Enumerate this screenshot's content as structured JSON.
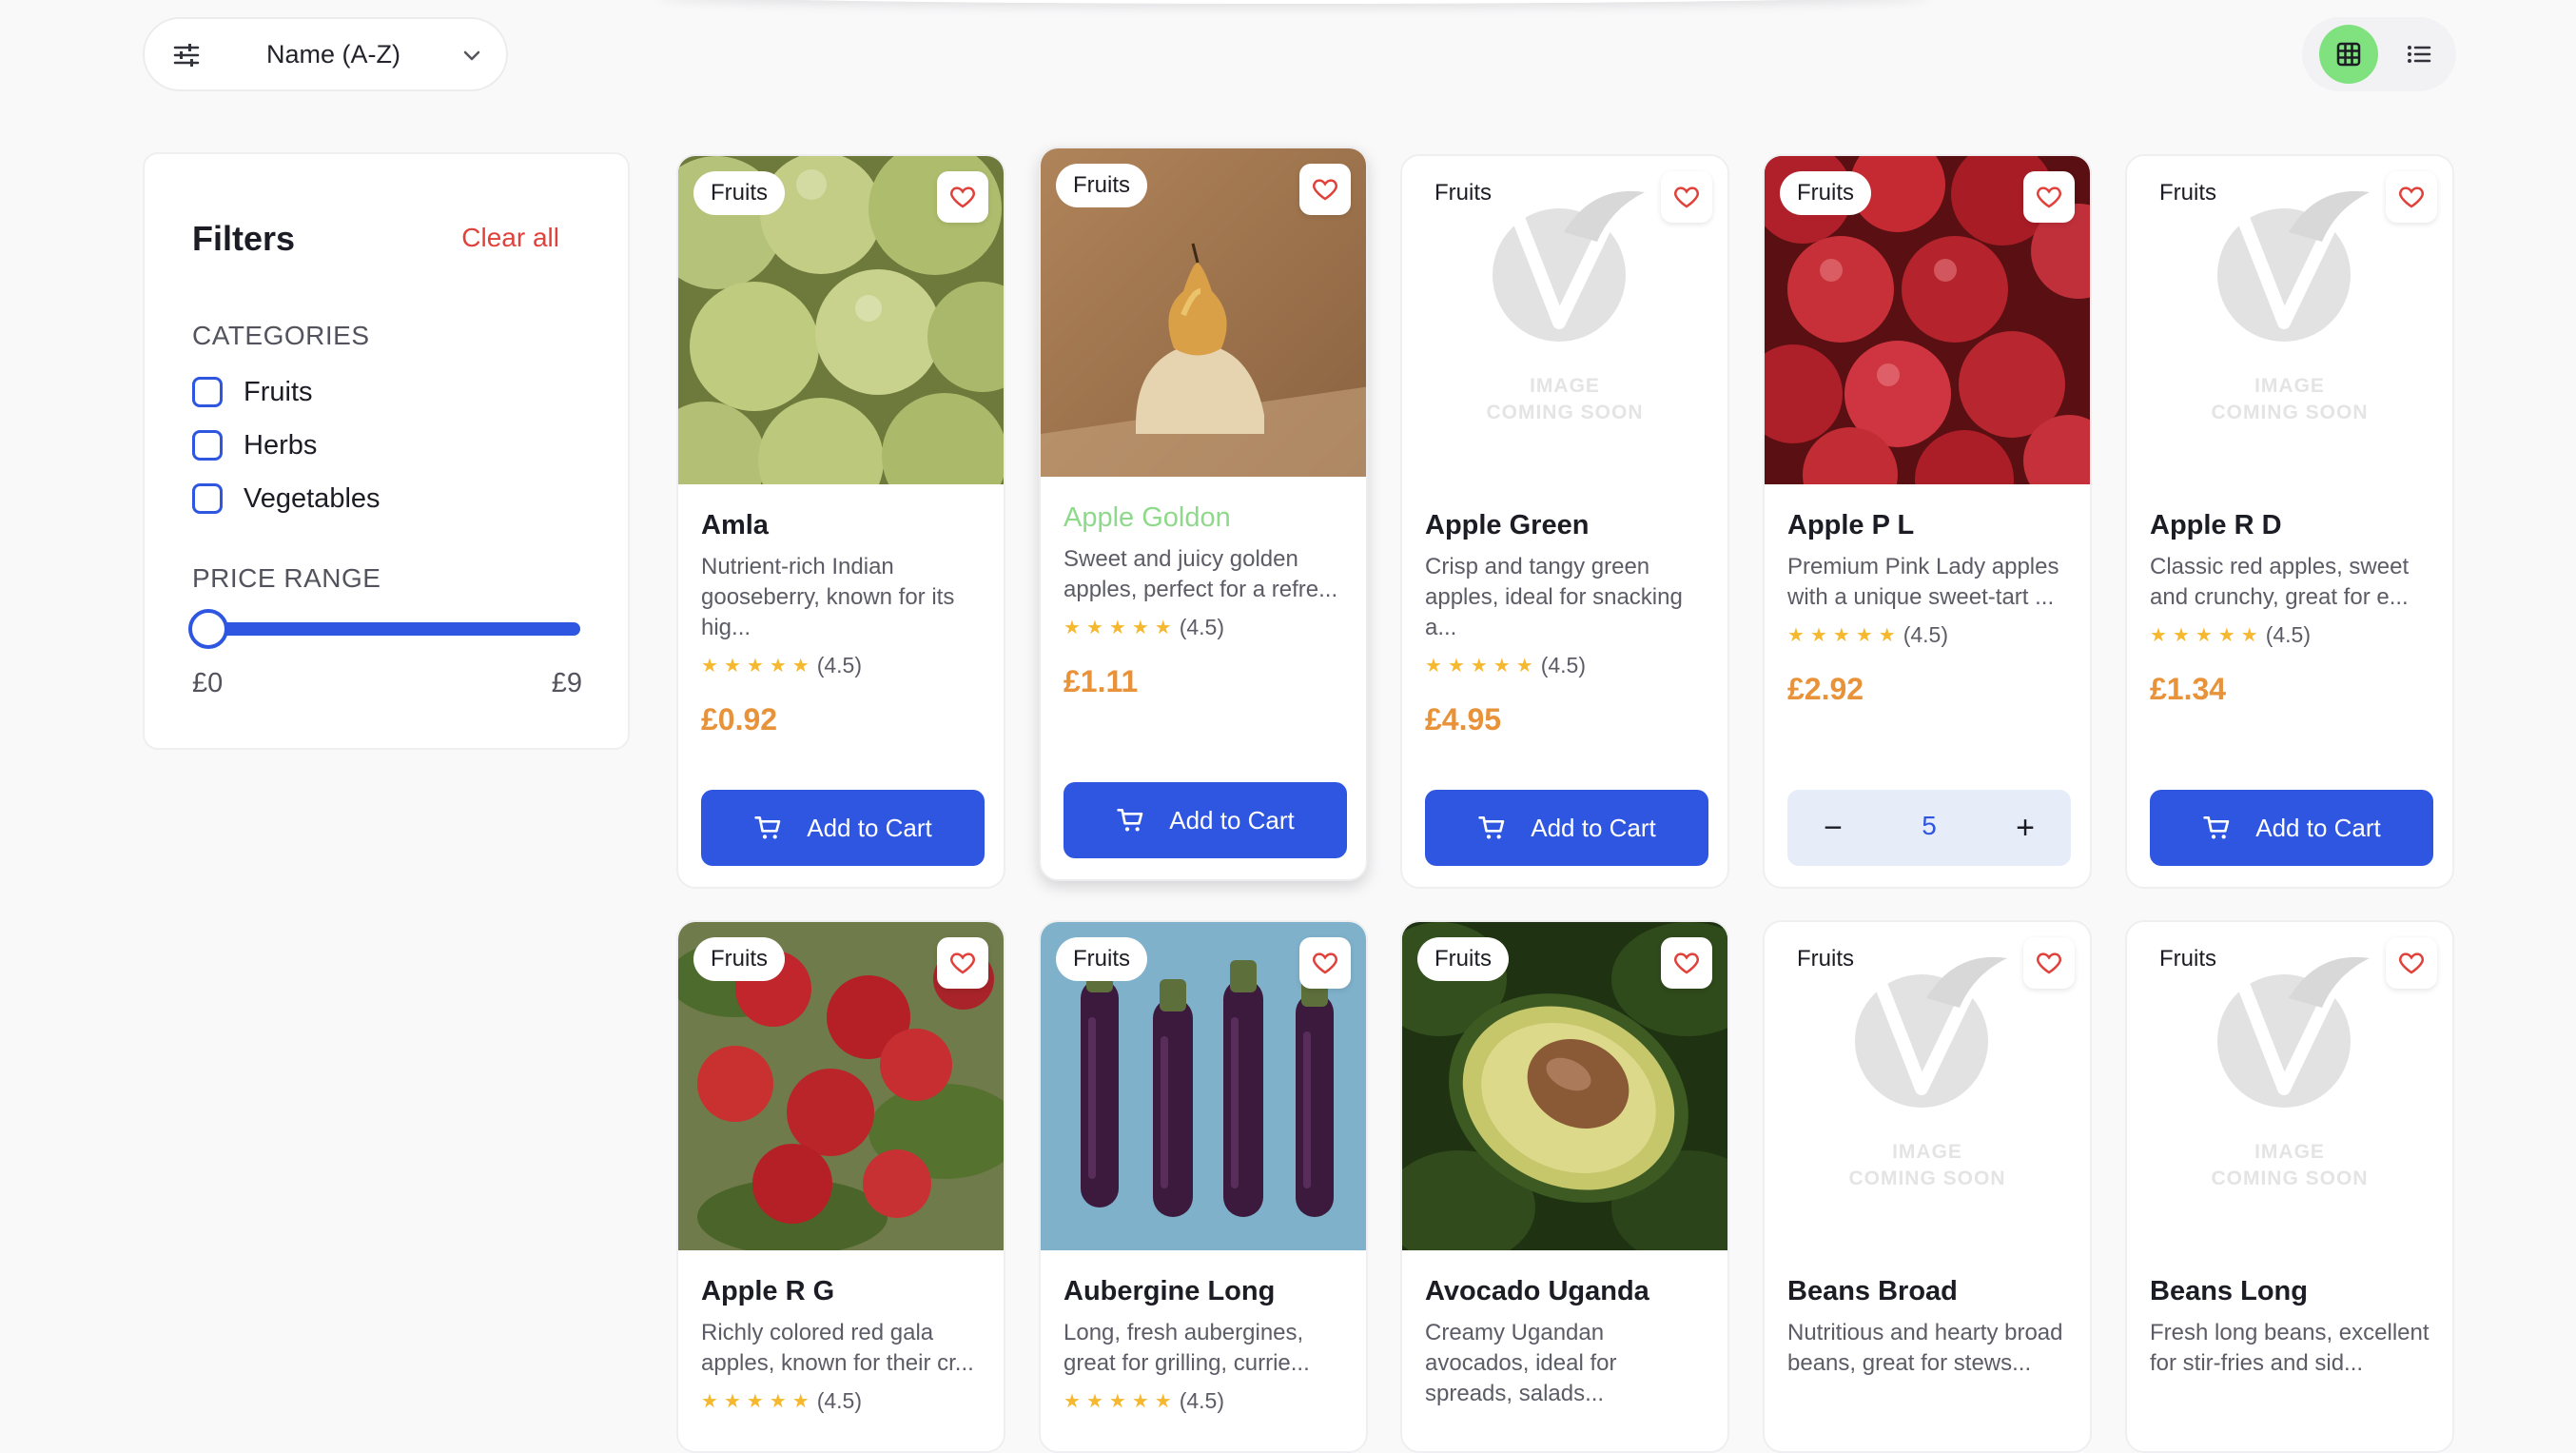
{
  "toolbar": {
    "sort_label": "Name (A-Z)",
    "filter_icon": "sliders-icon",
    "sort_chevron_icon": "chevron-down-icon",
    "grid_view_icon": "grid-icon",
    "list_view_icon": "list-icon",
    "active_view": "grid",
    "active_color": "#7fe27f"
  },
  "filters": {
    "title": "Filters",
    "clear_all": "Clear all",
    "categories_heading": "CATEGORIES",
    "categories": [
      {
        "label": "Fruits",
        "checked": false
      },
      {
        "label": "Herbs",
        "checked": false
      },
      {
        "label": "Vegetables",
        "checked": false
      }
    ],
    "price_heading": "PRICE RANGE",
    "price_min": "£0",
    "price_max": "£9",
    "slider_value": 0
  },
  "placeholder_text": {
    "line1": "IMAGE",
    "line2": "COMING SOON"
  },
  "products": [
    {
      "category": "Fruits",
      "name": "Amla",
      "desc": "Nutrient-rich Indian gooseberry, known for its hig...",
      "rating": "(4.5)",
      "price": "£0.92",
      "action": "Add to Cart"
    },
    {
      "category": "Fruits",
      "name": "Apple Goldon",
      "desc": "Sweet and juicy golden apples, perfect for a refre...",
      "rating": "(4.5)",
      "price": "£1.11",
      "action": "Add to Cart"
    },
    {
      "category": "Fruits",
      "name": "Apple Green",
      "desc": "Crisp and tangy green apples, ideal for snacking a...",
      "rating": "(4.5)",
      "price": "£4.95",
      "action": "Add to Cart"
    },
    {
      "category": "Fruits",
      "name": "Apple P L",
      "desc": "Premium Pink Lady apples with a unique sweet-tart ...",
      "rating": "(4.5)",
      "price": "£2.92",
      "quantity": "5",
      "minus": "−",
      "plus": "+"
    },
    {
      "category": "Fruits",
      "name": "Apple R D",
      "desc": "Classic red apples, sweet and crunchy, great for e...",
      "rating": "(4.5)",
      "price": "£1.34",
      "action": "Add to Cart"
    },
    {
      "category": "Fruits",
      "name": "Apple R G",
      "desc": "Richly colored red gala apples, known for their cr...",
      "rating": "(4.5)"
    },
    {
      "category": "Fruits",
      "name": "Aubergine Long",
      "desc": "Long, fresh aubergines, great for grilling, currie...",
      "rating": "(4.5)"
    },
    {
      "category": "Fruits",
      "name": "Avocado Uganda",
      "desc": "Creamy Ugandan avocados, ideal for spreads, salads..."
    },
    {
      "category": "Fruits",
      "name": "Beans Broad",
      "desc": "Nutritious and hearty broad beans, great for stews..."
    },
    {
      "category": "Fruits",
      "name": "Beans Long",
      "desc": "Fresh long beans, excellent for stir-fries and sid..."
    }
  ],
  "colors": {
    "primary": "#2f56e0",
    "price": "#e8923a",
    "clear_all": "#e0413a",
    "highlight_name": "#8ed98a",
    "star": "#f5b82e",
    "heart": "#e0413a"
  }
}
